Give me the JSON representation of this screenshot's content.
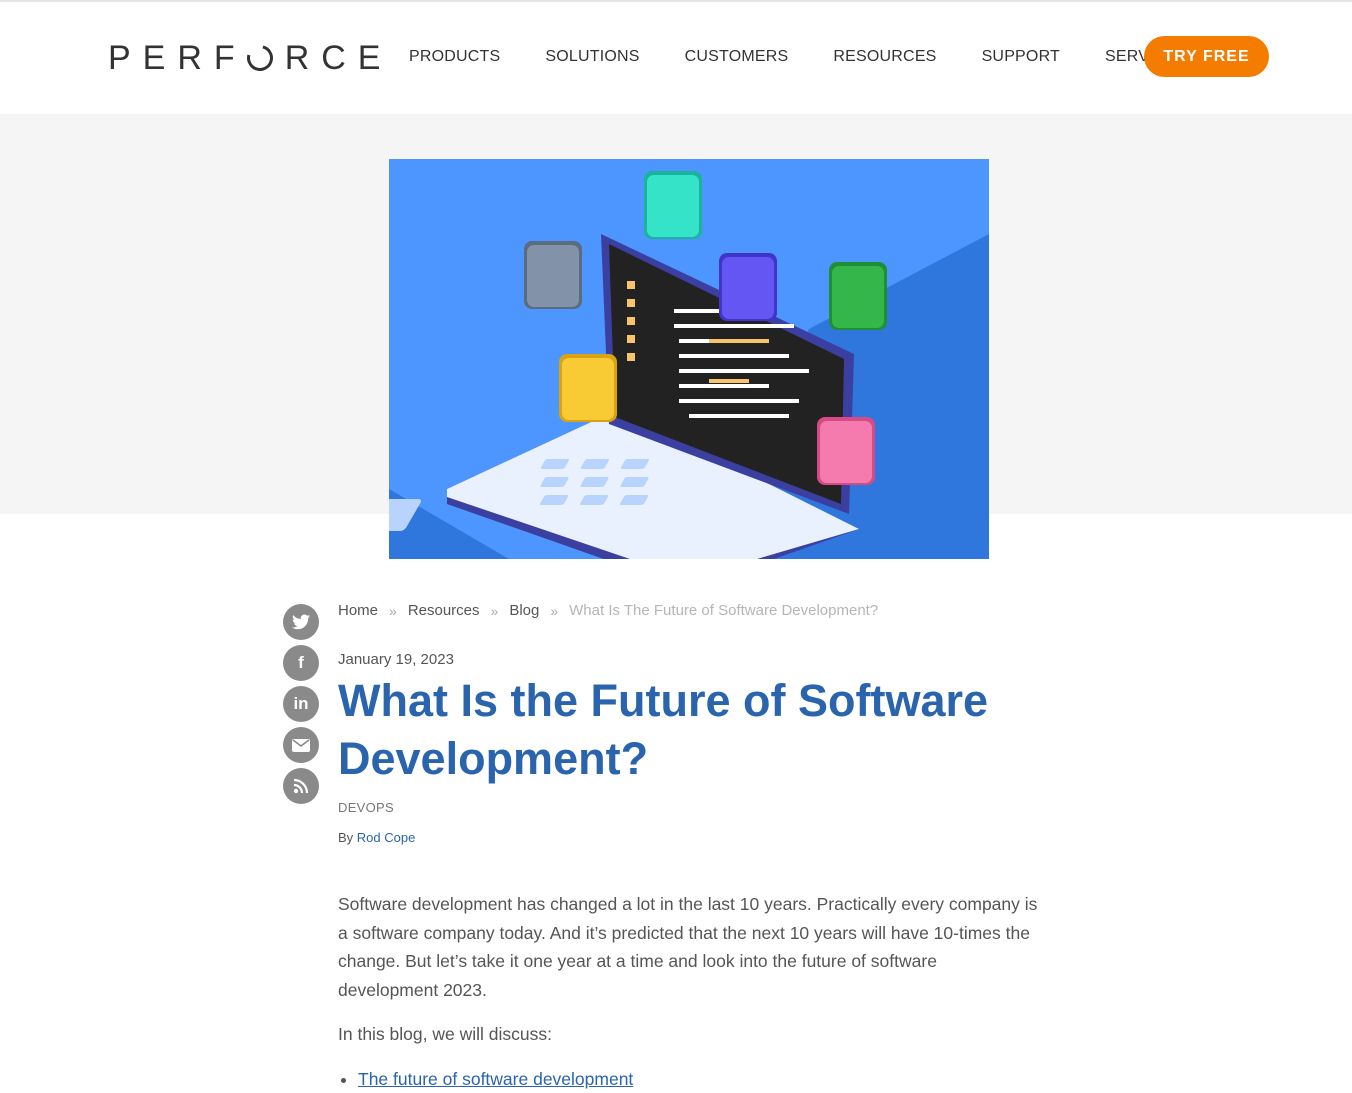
{
  "header": {
    "logo_text": "PERFORCE",
    "nav": [
      "PRODUCTS",
      "SOLUTIONS",
      "CUSTOMERS",
      "RESOURCES",
      "SUPPORT",
      "SERVICES"
    ],
    "cta_label": "TRY FREE",
    "cta_color": "#f47c00"
  },
  "social": [
    "twitter-icon",
    "facebook-icon",
    "linkedin-icon",
    "email-icon",
    "rss-icon"
  ],
  "breadcrumb": {
    "home": "Home",
    "resources": "Resources",
    "blog": "Blog",
    "current": "What Is The Future of Software Development?",
    "separator": "»"
  },
  "article": {
    "date": "January 19, 2023",
    "title": "What Is the Future of Software Development?",
    "tag": "DEVOPS",
    "by": "By",
    "author": "Rod Cope",
    "paragraphs": [
      "Software development has changed a lot in the last 10 years. Practically every company is a software company today. And it’s predicted that the next 10 years will have 10-times the change. But let’s take it one year at a time and look into the future of software development 2023.",
      "In this blog, we will discuss:"
    ],
    "list": [
      "The future of software development"
    ],
    "title_color": "#2a64ad"
  }
}
